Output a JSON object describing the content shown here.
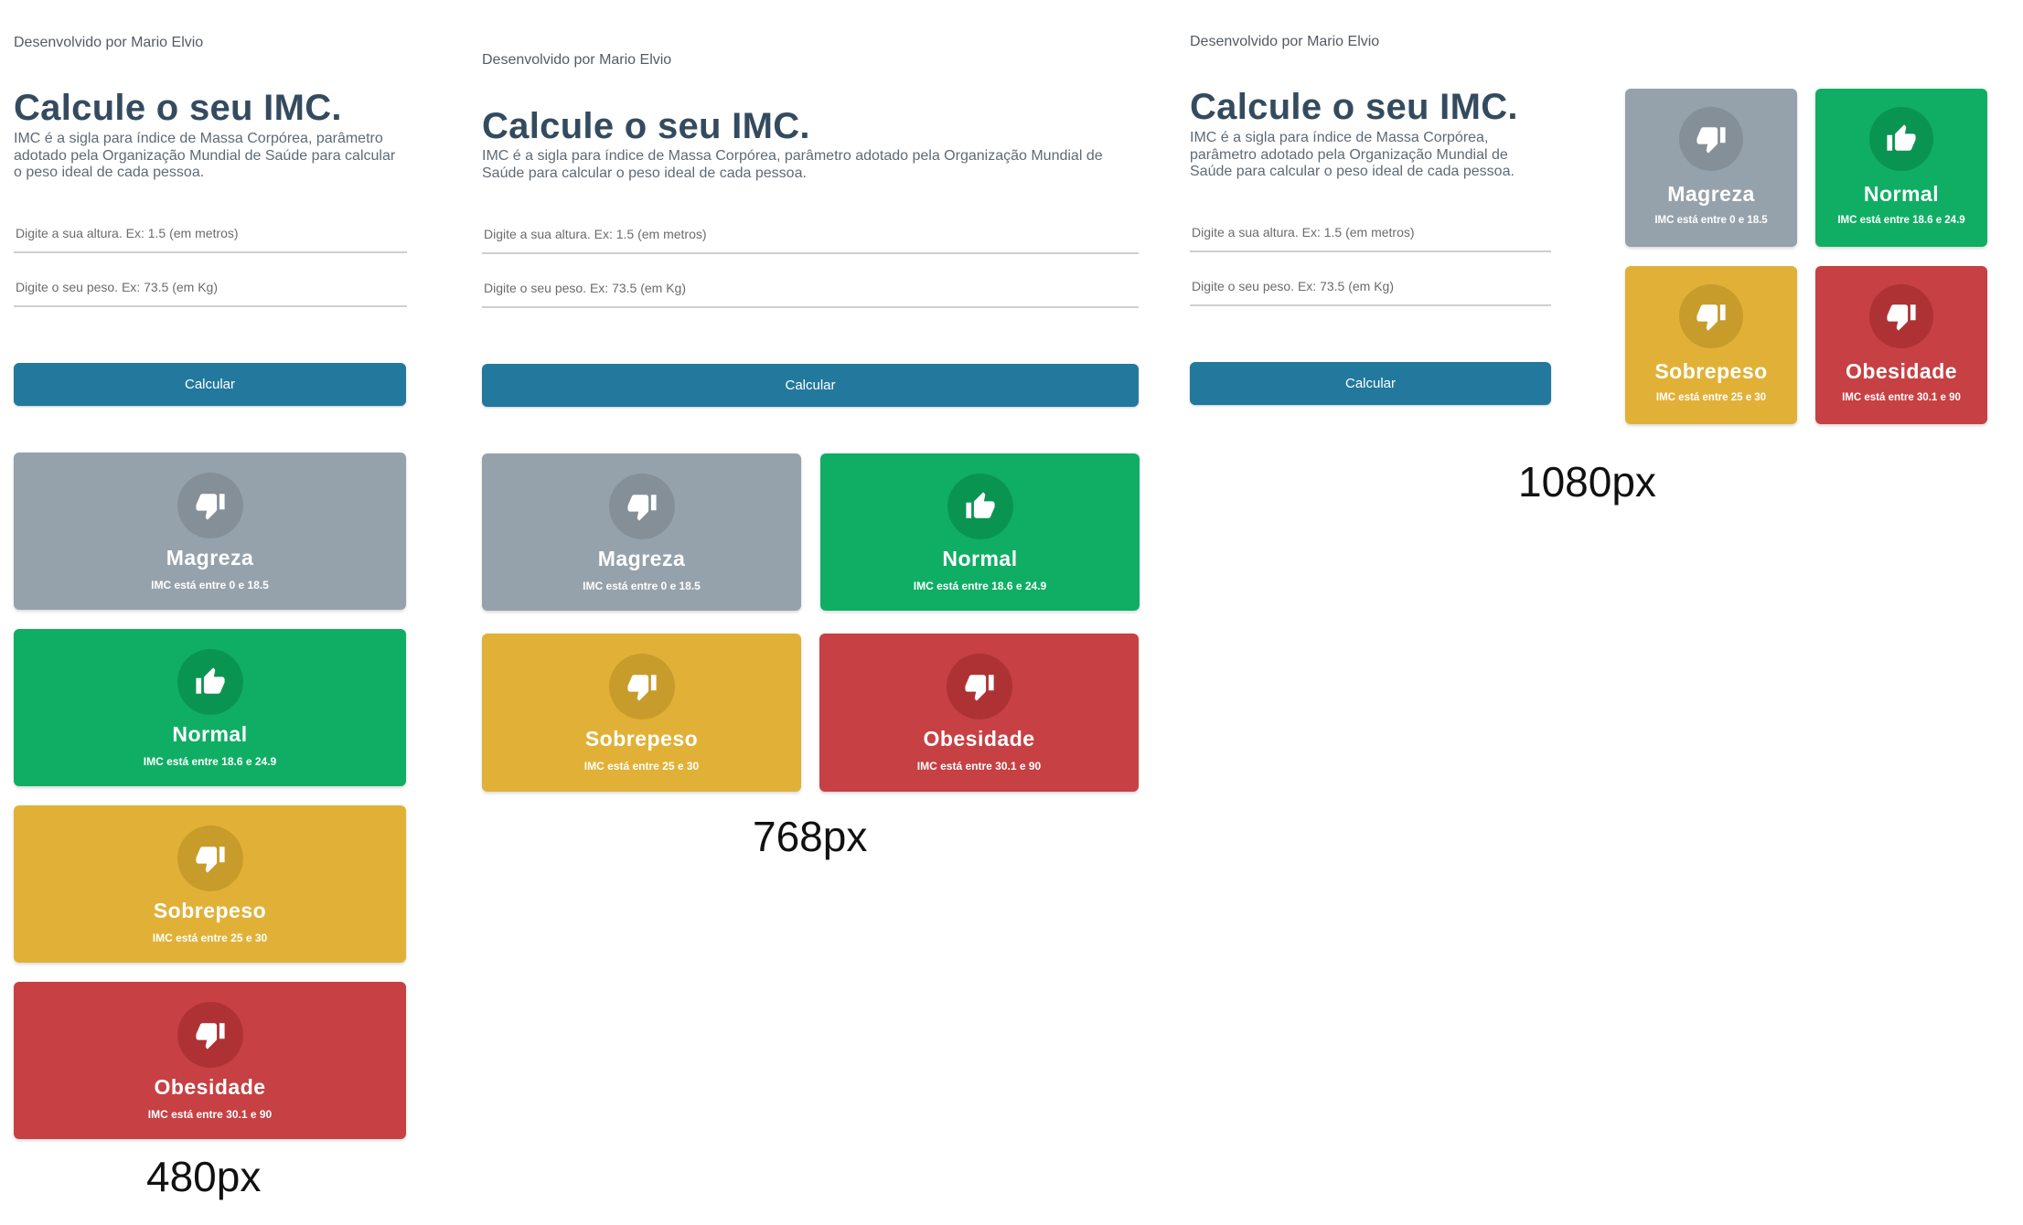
{
  "app": {
    "credit": "Desenvolvido por Mario Elvio",
    "title": "Calcule o seu IMC.",
    "description": "IMC é a sigla para índice de Massa Corpórea, parâmetro adotado pela Organização Mundial de Saúde para calcular o peso ideal de cada pessoa.",
    "height_placeholder": "Digite a sua altura. Ex: 1.5 (em metros)",
    "weight_placeholder": "Digite o seu peso. Ex: 73.5 (em Kg)",
    "button_label": "Calcular"
  },
  "cards": [
    {
      "key": "magreza",
      "name": "Magreza",
      "range": "IMC está entre 0 e 18.5",
      "icon": "thumbs-down-icon",
      "color": "#96a2ab"
    },
    {
      "key": "normal",
      "name": "Normal",
      "range": "IMC está entre 18.6 e 24.9",
      "icon": "thumbs-up-icon",
      "color": "#10ae64"
    },
    {
      "key": "sobrepeso",
      "name": "Sobrepeso",
      "range": "IMC está entre 25 e 30",
      "icon": "thumbs-down-icon",
      "color": "#e1b137"
    },
    {
      "key": "obesidade",
      "name": "Obesidade",
      "range": "IMC está entre 30.1 e 90",
      "icon": "thumbs-down-icon",
      "color": "#c74043"
    }
  ],
  "captions": {
    "mobile": "480px",
    "tablet": "768px",
    "desktop": "1080px"
  },
  "colors": {
    "title": "#344b5f",
    "button": "#23789d"
  }
}
